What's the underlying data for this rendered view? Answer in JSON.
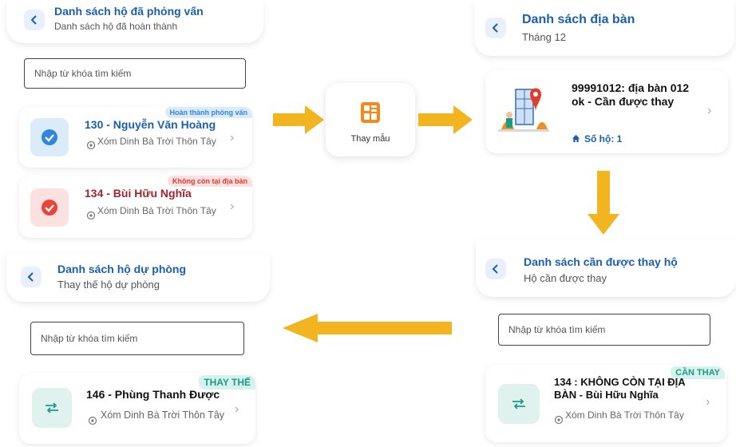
{
  "panel_interviewed": {
    "title": "Danh sách hộ đã phỏng vấn",
    "subtitle": "Danh sách hộ đã hoàn thành",
    "search_placeholder": "Nhập từ khóa tìm kiếm",
    "items": [
      {
        "badge": "Hoàn thành phỏng vấn",
        "name": "130 - Nguyễn Văn Hoàng",
        "address": "Xóm Dinh Bà Trời Thôn Tây",
        "status_color": "#2f86dc"
      },
      {
        "badge": "Không còn tại địa bàn",
        "name": "134 - Bùi Hữu Nghĩa",
        "address": "Xóm Dinh Bà Trời Thôn Tây",
        "status_color": "#e8443b"
      }
    ]
  },
  "center_button": {
    "label": "Thay mẫu",
    "icon": "calculator-icon",
    "color": "#f08a1c"
  },
  "panel_areas": {
    "title": "Danh sách địa bàn",
    "subtitle": "Tháng 12",
    "card": {
      "title": "99991012: địa bàn 012 ok - Cần được thay",
      "households_label": "Số hộ: 1"
    }
  },
  "panel_need_replace": {
    "title": "Danh sách cần được thay hộ",
    "subtitle": "Hộ cần được thay",
    "search_placeholder": "Nhập từ khóa tìm kiếm",
    "item": {
      "badge": "CẦN THAY",
      "name": "134 : KHÔNG CÒN TẠI ĐỊA BÀN - Bùi Hữu Nghĩa",
      "address": "Xóm Dinh Bà Trời Thôn Tây"
    }
  },
  "panel_reserve": {
    "title": "Danh sách hộ dự phòng",
    "subtitle": "Thay thế hộ dự phòng",
    "search_placeholder": "Nhập từ khóa tìm kiếm",
    "item": {
      "badge": "THAY THẾ",
      "name": "146 - Phùng Thanh Được",
      "address": "Xóm Dinh Bà Trời Thôn Tây"
    }
  },
  "colors": {
    "primary": "#1b5fae",
    "arrow": "#f3b51f",
    "teal": "#1e9a88",
    "red": "#c0262d"
  }
}
